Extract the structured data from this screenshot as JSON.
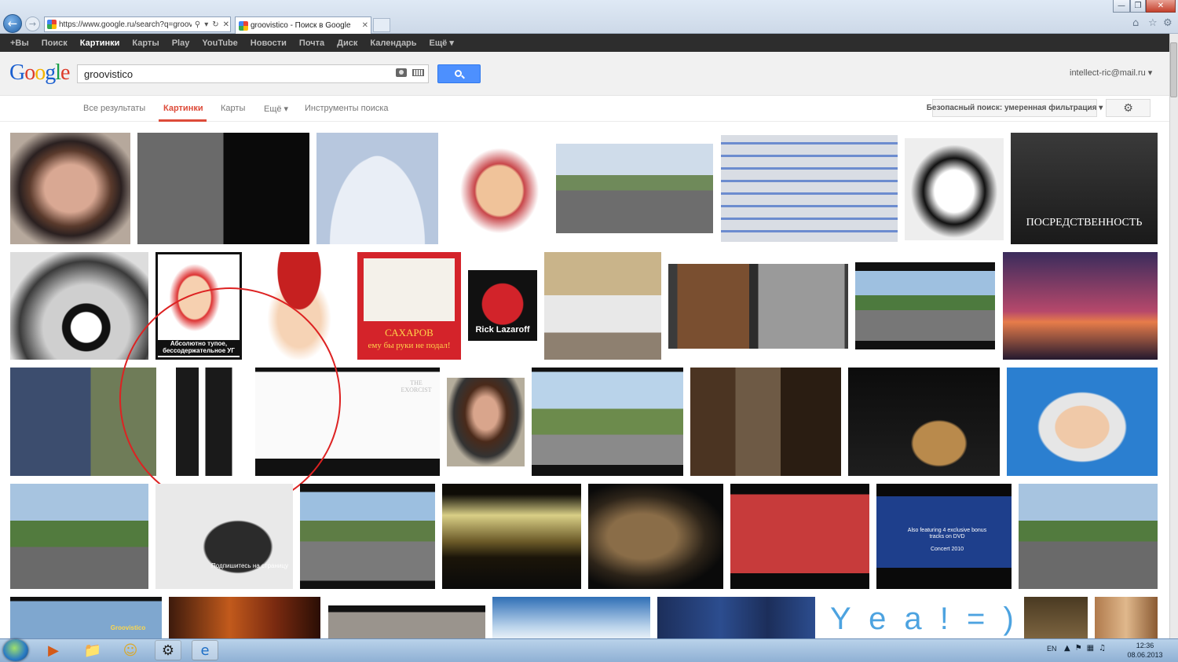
{
  "browser": {
    "url": "https://www.google.ru/search?q=groovi",
    "tab_title": "groovistico - Поиск в Google",
    "back_icon": "arrow-left",
    "forward_icon": "arrow-right"
  },
  "google_bar": {
    "items": [
      "+Вы",
      "Поиск",
      "Картинки",
      "Карты",
      "Play",
      "YouTube",
      "Новости",
      "Почта",
      "Диск",
      "Календарь",
      "Ещё ▾"
    ],
    "active": "Картинки"
  },
  "header": {
    "logo": "Google",
    "query": "groovistico",
    "account": "intellect-ric@mail.ru ▾"
  },
  "subnav": {
    "all": "Все результаты",
    "images": "Картинки",
    "maps": "Карты",
    "more": "Ещё ▾",
    "tools": "Инструменты поиска",
    "safesearch": "Безопасный поиск: умеренная фильтрация ▾"
  },
  "thumb_texts": {
    "posred": "ПОСРЕДСТВЕННОСТЬ",
    "absol": "Абсолютно тупое, бессодержательное УГ",
    "sakharov1": "САХАРОВ",
    "sakharov2": "ему бы руки не подал!",
    "rick": "Rick Lazaroff",
    "yeah": "Y e a ! = )",
    "groovistico": "Groovistico",
    "podpis": "Подпишитесь на страницу",
    "dvd": "Also featuring 4 exclusive bonus tracks on DVD",
    "concert": "Concert 2010",
    "exorcist": "THE EXORCIST"
  },
  "taskbar": {
    "lang": "EN",
    "time": "12:36",
    "date": "08.06.2013"
  },
  "colors": {
    "accent_red": "#dd4b39",
    "search_blue": "#4d90fe",
    "gbar_bg": "#2d2d2d"
  }
}
